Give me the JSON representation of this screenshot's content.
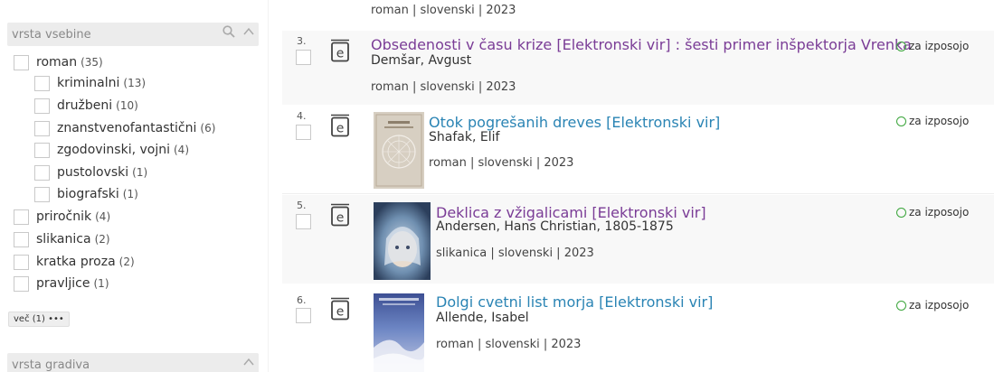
{
  "sidebar": {
    "facet1": {
      "title": "vrsta vsebine",
      "items": [
        {
          "label": "roman",
          "count": "(35)"
        },
        {
          "label": "kriminalni",
          "count": "(13)"
        },
        {
          "label": "družbeni",
          "count": "(10)"
        },
        {
          "label": "znanstvenofantastični",
          "count": "(6)"
        },
        {
          "label": "zgodovinski, vojni",
          "count": "(4)"
        },
        {
          "label": "pustolovski",
          "count": "(1)"
        },
        {
          "label": "biografski",
          "count": "(1)"
        },
        {
          "label": "priročnik",
          "count": "(4)"
        },
        {
          "label": "slikanica",
          "count": "(2)"
        },
        {
          "label": "kratka proza",
          "count": "(2)"
        },
        {
          "label": "pravljice",
          "count": "(1)"
        }
      ],
      "more_label": "več (1) •••"
    },
    "facet2": {
      "title": "vrsta gradiva"
    }
  },
  "icons": {
    "search": "search-icon",
    "collapse": "chevron-up-icon",
    "ebook": "e-book-icon",
    "available": "available-circle-icon"
  },
  "colors": {
    "link": "#2a84b4",
    "visited": "#7a3c96",
    "available": "#3aa53a"
  },
  "results": {
    "top_meta": "roman | slovenski | 2023",
    "items": [
      {
        "num": "3.",
        "title": "Obsedenosti v času krize [Elektronski vir] : šesti primer inšpektorja Vrenka",
        "author": "Demšar, Avgust",
        "meta": "roman | slovenski | 2023",
        "availability": "za izposojo"
      },
      {
        "num": "4.",
        "title": "Otok pogrešanih dreves [Elektronski vir]",
        "author": "Shafak, Elif",
        "meta": "roman | slovenski | 2023",
        "availability": "za izposojo"
      },
      {
        "num": "5.",
        "title": "Deklica z vžigalicami [Elektronski vir]",
        "author": "Andersen, Hans Christian, 1805-1875",
        "meta": "slikanica | slovenski | 2023",
        "availability": "za izposojo"
      },
      {
        "num": "6.",
        "title": "Dolgi cvetni list morja [Elektronski vir]",
        "author": "Allende, Isabel",
        "meta": "roman | slovenski | 2023",
        "availability": "za izposojo"
      }
    ]
  }
}
